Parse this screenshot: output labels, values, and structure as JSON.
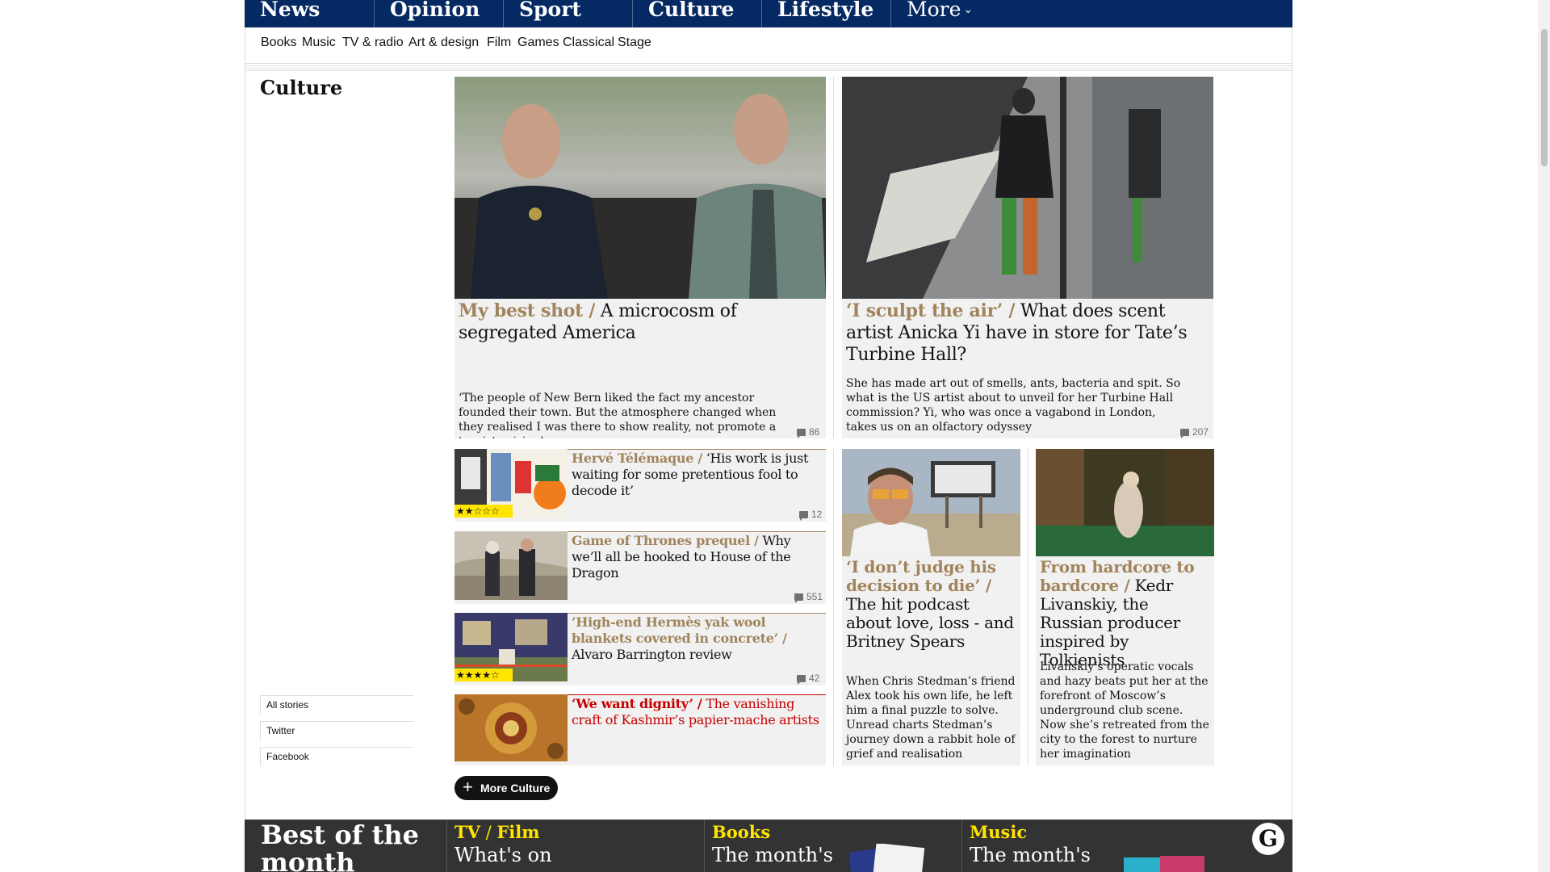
{
  "nav": {
    "pillars": [
      "News",
      "Opinion",
      "Sport",
      "Culture",
      "Lifestyle"
    ],
    "more": "More"
  },
  "subnav": [
    "Books",
    "Music",
    "TV & radio",
    "Art & design",
    "Film",
    "Games",
    "Classical",
    "Stage"
  ],
  "section": {
    "title": "Culture",
    "links": [
      "All stories",
      "Twitter",
      "Facebook"
    ],
    "more_button": "More Culture"
  },
  "cards": {
    "c1": {
      "kicker": "My best shot /",
      "headline": " A microcosm of segregated America",
      "trail": "‘The people of New Bern liked the fact my ancestor founded their town. But the atmosphere changed when they realised I was there to show reality, not promote a touristy vision’",
      "comments": "86"
    },
    "c2": {
      "kicker": "‘I sculpt the air’ /",
      "headline": " What does scent artist Anicka Yi have in store for Tate’s Turbine Hall?",
      "trail": "She has made art out of smells, ants, bacteria and spit. So what is the US artist about to unveil for her Turbine Hall commission? Yi, who was once a vagabond in London, takes us on an olfactory odyssey",
      "comments": "207"
    },
    "c3": {
      "kicker": "Hervé Télémaque /",
      "headline": " ‘His work is just waiting for some pretentious fool to decode it’",
      "comments": "12",
      "stars": "★★☆☆☆",
      "rating": 2
    },
    "c4": {
      "kicker": "Game of Thrones prequel /",
      "headline": " Why we’ll all be hooked to House of the Dragon",
      "comments": "551"
    },
    "c5": {
      "kicker": "‘High-end Hermès yak wool blankets covered in concrete’ /",
      "headline": " Alvaro Barrington review",
      "comments": "42",
      "stars": "★★★★☆",
      "rating": 4
    },
    "c6": {
      "kicker": "‘We want dignity’ /",
      "headline": " The vanishing craft of Kashmir’s papier-mache artists"
    },
    "c7": {
      "kicker": "‘I don’t judge his decision to die’ /",
      "headline": " The hit podcast about love, loss - and Britney Spears",
      "trail": "When Chris Stedman’s friend Alex took his own life, he left him a final puzzle to solve. Unread charts Stedman’s journey down a rabbit hole of grief and realisation"
    },
    "c8": {
      "kicker": "From hardcore to bardcore /",
      "headline": " Kedr Livanskiy, the Russian producer inspired by Tolkienists",
      "trail": "Livanskiy’s operatic vocals and hazy beats put her at the forefront of Moscow’s underground club scene. Now she’s retreated from the city to the forest to nurture her imagination"
    }
  },
  "bottom": {
    "title": "Best of the month",
    "cols": [
      {
        "label": "TV",
        "label2": "Film",
        "title": "What's on"
      },
      {
        "label": "Books",
        "title": "The month's"
      },
      {
        "label": "Music",
        "title": "The month's"
      }
    ],
    "logo": "G"
  },
  "colors": {
    "brand_navy": "#052962",
    "culture_kicker": "#a1845c",
    "news_red": "#c70000",
    "star_yellow": "#ffe500"
  }
}
